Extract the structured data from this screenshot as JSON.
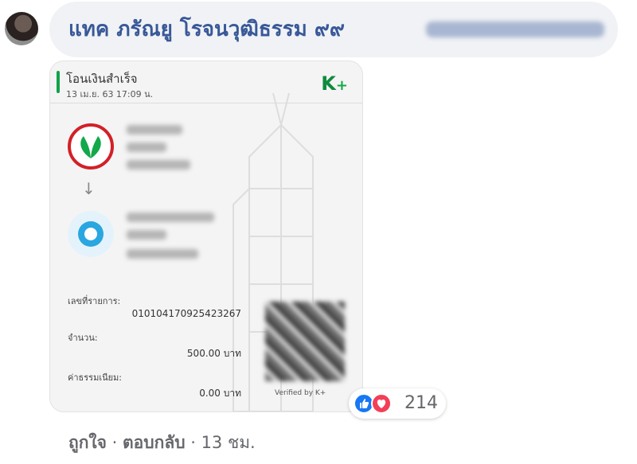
{
  "comment": {
    "author": "แทค ภรัณยู โรจนวุฒิธรรม ๙๙"
  },
  "slip": {
    "title": "โอนเงินสำเร็จ",
    "datetime": "13 เม.ย. 63  17:09 น.",
    "brand": "K",
    "brand_plus": "+",
    "arrow": "↓",
    "ref_label": "เลขที่รายการ:",
    "ref_value": "010104170925423267",
    "amount_label": "จำนวน:",
    "amount_value": "500.00 บาท",
    "fee_label": "ค่าธรรมเนียม:",
    "fee_value": "0.00 บาท",
    "verified": "Verified by K+"
  },
  "reactions": {
    "count": "214"
  },
  "actions": {
    "like": "ถูกใจ",
    "sep1": " · ",
    "reply": "ตอบกลับ",
    "sep2": " · ",
    "time": "13 ชม."
  },
  "colors": {
    "author": "#385898",
    "kbank_green": "#13a84a",
    "like_blue": "#1877f2",
    "love_red": "#f33e58"
  }
}
